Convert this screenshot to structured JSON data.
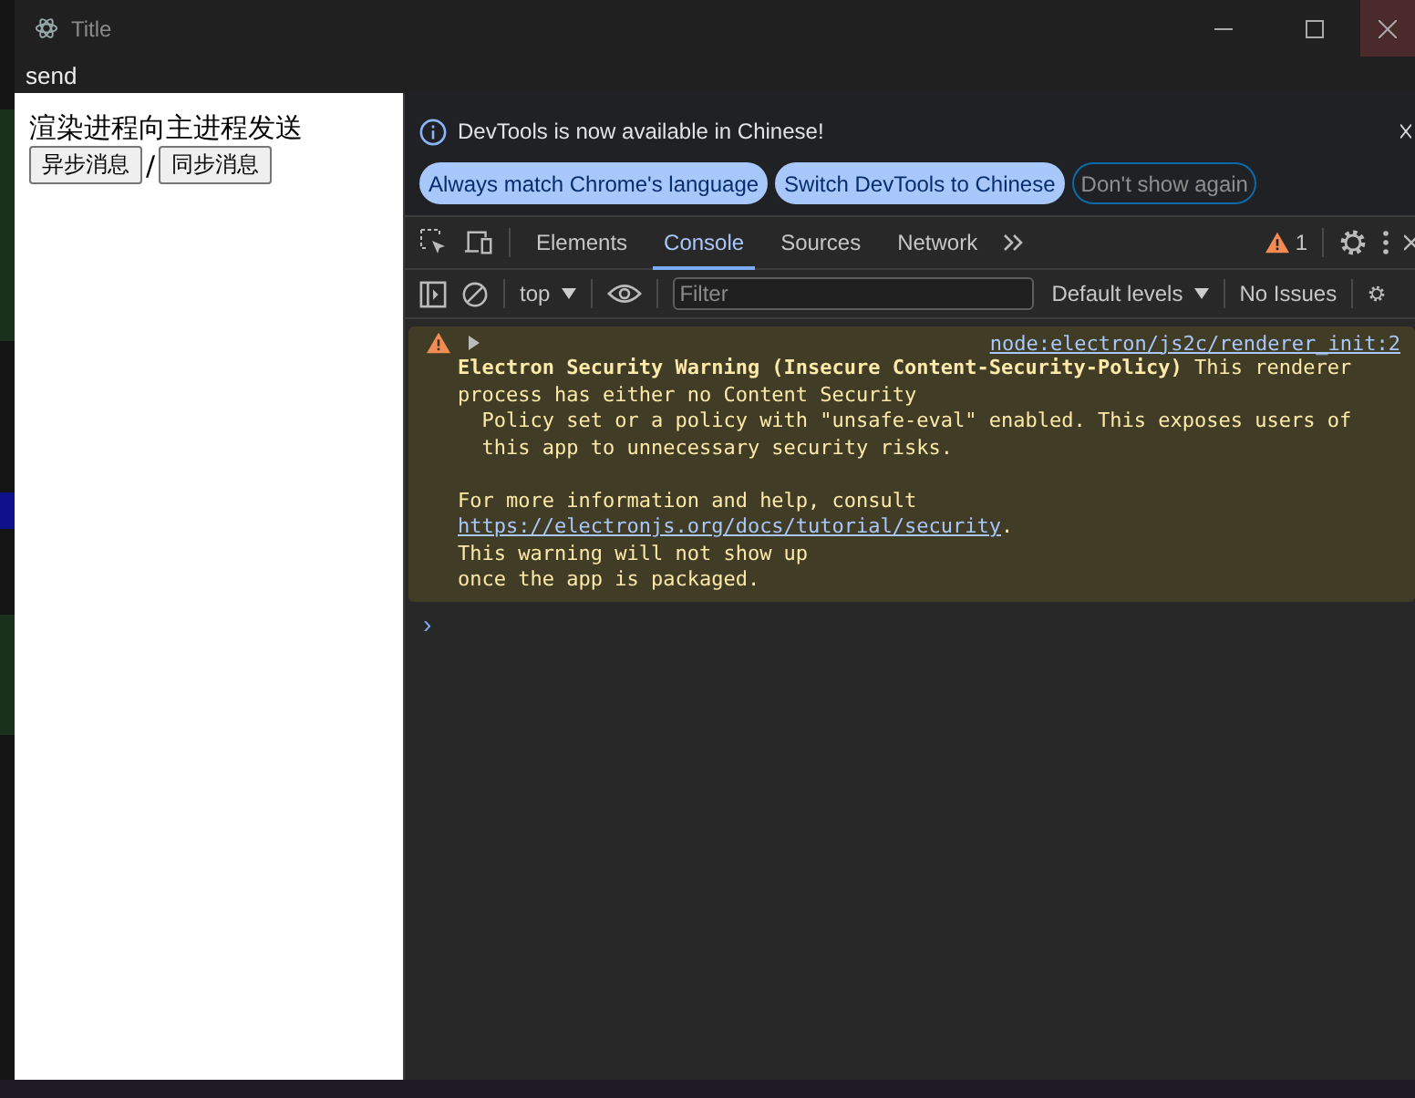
{
  "window": {
    "title": "Title"
  },
  "menu": [
    "send"
  ],
  "page": {
    "heading": "渲染进程向主进程发送",
    "buttons": [
      "异步消息",
      "同步消息"
    ],
    "separator": "/"
  },
  "devtools": {
    "infobar": {
      "message": "DevTools is now available in Chinese!",
      "buttons": [
        {
          "label": "Always match Chrome's language",
          "kind": "filled"
        },
        {
          "label": "Switch DevTools to Chinese",
          "kind": "filled"
        },
        {
          "label": "Don't show again",
          "kind": "outline"
        }
      ]
    },
    "tabs": [
      {
        "label": "Elements",
        "selected": false
      },
      {
        "label": "Console",
        "selected": true
      },
      {
        "label": "Sources",
        "selected": false
      },
      {
        "label": "Network",
        "selected": false
      }
    ],
    "warning_count": "1",
    "console_toolbar": {
      "context": "top",
      "filter_placeholder": "Filter",
      "levels": "Default levels",
      "issues": "No Issues"
    },
    "messages": [
      {
        "kind": "warning",
        "source": "node:electron/js2c/renderer_init:2",
        "text_before": "**Electron Security Warning (Insecure Content-Security-Policy)** This renderer\nprocess has either no Content Security\n  Policy set or a policy with \"unsafe-eval\" enabled. This exposes users of\n  this app to unnecessary security risks.\n\nFor more information and help, consult\n",
        "link": "https://electronjs.org/docs/tutorial/security",
        "text_after": ".\nThis warning will not show up\nonce the app is packaged."
      }
    ],
    "prompt": "›"
  }
}
